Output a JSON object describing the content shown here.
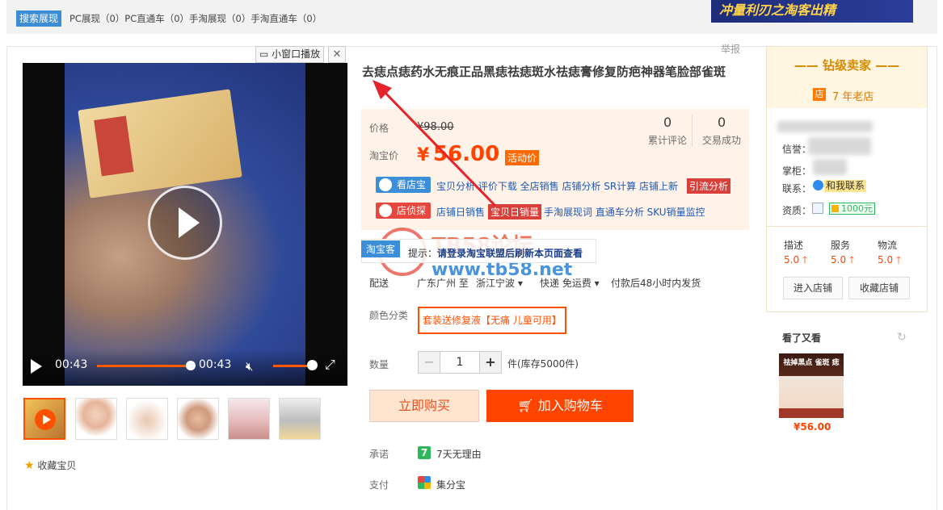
{
  "topbar": {
    "search_tag": "搜索展现",
    "stats": "PC展现（0）PC直通车（0）手淘展现（0）手淘直通车（0）",
    "banner": "冲量利刃之淘客出精"
  },
  "video": {
    "mini_window_label": "小窗口播放",
    "close": "✕",
    "current_time": "00:43",
    "duration": "00:43",
    "progress_fraction": 1.0,
    "volume_fraction": 0.9
  },
  "thumbs_count": 6,
  "collect_label": "收藏宝贝",
  "report_label": "举报",
  "product": {
    "title": "去痣点痣药水无痕正品黑痣祛痣斑水祛痣膏修复防疤神器笔脸部雀斑",
    "price_label": "价格",
    "original_price": "¥98.00",
    "taobao_price_label": "淘宝价",
    "currency": "¥",
    "price": "56.00",
    "activity_tag": "活动价",
    "reviews_count": "0",
    "reviews_label": "累计评论",
    "sales_count": "0",
    "sales_label": "交易成功"
  },
  "tools": {
    "kandianbao": "看店宝",
    "kandianbao_links": "宝贝分析 评价下载 全店销售 店铺分析 SR计算 店铺上新",
    "kandianbao_tag": "引流分析",
    "diantan": "店侦探",
    "diantan_link1": "店铺日销售",
    "diantan_tag": "宝贝日销量",
    "diantan_links": "手淘展现词 直通车分析 SKU销量监控"
  },
  "watermark": {
    "line1": "TB58论坛",
    "line2": "www.tb58.net"
  },
  "tip": {
    "tag": "淘宝客",
    "text_prefix": "提示：",
    "text": "请登录淘宝联盟后刷新本页面查看"
  },
  "shipping": {
    "label": "配送",
    "from": "广东广州 至",
    "to": "浙江宁波",
    "method": "快递 免运费",
    "time": "付款后48小时内发货"
  },
  "sku": {
    "label": "颜色分类",
    "selected": "套装送修复液【无痛 儿童可用】"
  },
  "quantity": {
    "label": "数量",
    "minus": "−",
    "value": "1",
    "plus": "+",
    "stock": "件(库存5000件)"
  },
  "actions": {
    "buy_now": "立即购买",
    "add_to_cart": "加入购物车"
  },
  "promise": {
    "label": "承诺",
    "text": "7天无理由",
    "icon_text": "7"
  },
  "payment": {
    "label": "支付",
    "text": "集分宝"
  },
  "seller": {
    "title": "钻级卖家",
    "shop_icon": "店",
    "shop_age": "7 年老店",
    "credit_label": "信誉：",
    "keeper_label": "掌柜：",
    "contact_label": "联系：",
    "contact_button": "和我联系",
    "qualification_label": "资质：",
    "deposit": "1000元",
    "scores": [
      {
        "label": "描述",
        "value": "5.0"
      },
      {
        "label": "服务",
        "value": "5.0"
      },
      {
        "label": "物流",
        "value": "5.0"
      }
    ],
    "enter_shop": "进入店铺",
    "favorite_shop": "收藏店铺"
  },
  "seen": {
    "title": "看了又看",
    "price": "¥56.00",
    "image_caption": "祛掉黑点 雀斑 痣"
  },
  "colors": {
    "accent": "#ff4400",
    "link_blue": "#1d5ab6",
    "tag_blue": "#3d8ed8"
  }
}
